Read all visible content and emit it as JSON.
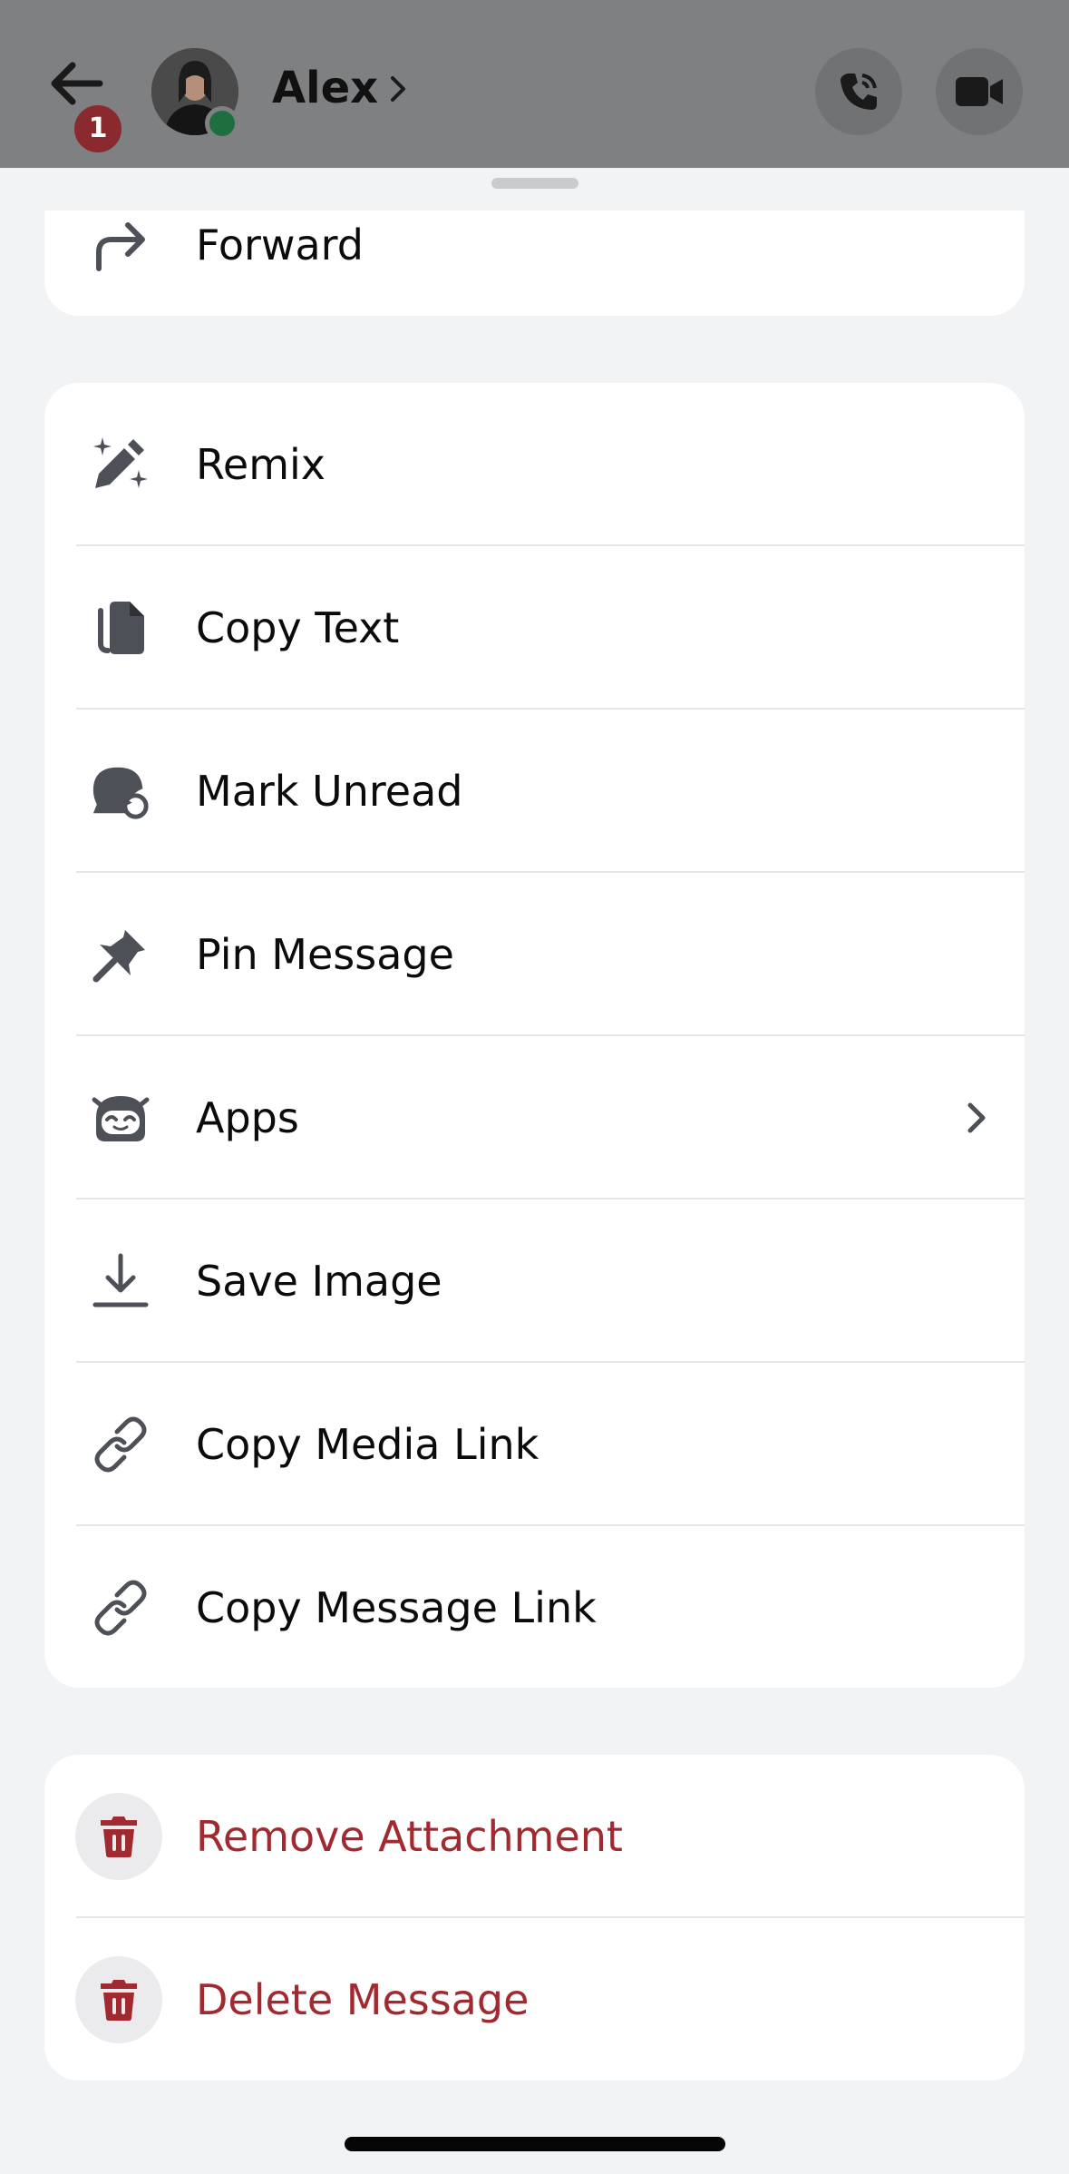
{
  "header": {
    "title": "Alex",
    "unread_badge": "1"
  },
  "forward_card": {
    "item": {
      "label": "Forward",
      "icon": "forward-arrow-icon"
    }
  },
  "menu": {
    "items": [
      {
        "label": "Remix",
        "icon": "remix-wand-icon"
      },
      {
        "label": "Copy Text",
        "icon": "copy-icon"
      },
      {
        "label": "Mark Unread",
        "icon": "mark-unread-icon"
      },
      {
        "label": "Pin Message",
        "icon": "pin-icon"
      },
      {
        "label": "Apps",
        "icon": "apps-robot-icon"
      },
      {
        "label": "Save Image",
        "icon": "download-icon"
      },
      {
        "label": "Copy Media Link",
        "icon": "link-icon"
      },
      {
        "label": "Copy Message Link",
        "icon": "link-icon"
      }
    ]
  },
  "danger": {
    "items": [
      {
        "label": "Remove Attachment",
        "icon": "trash-icon"
      },
      {
        "label": "Delete Message",
        "icon": "trash-icon"
      }
    ]
  },
  "colors": {
    "danger": "#a12930",
    "icon": "#4e5058",
    "online": "#1f6e3f"
  }
}
